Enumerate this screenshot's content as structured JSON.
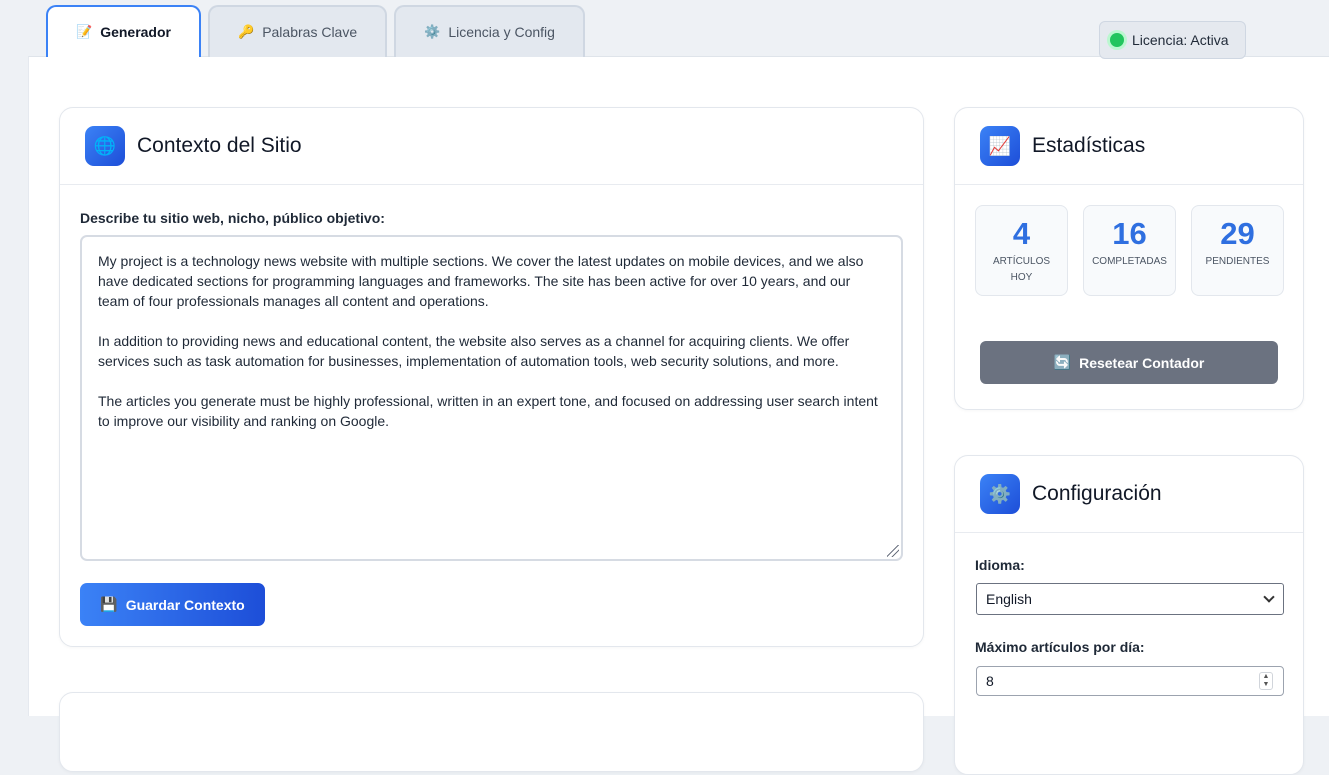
{
  "tabs": [
    {
      "label": "Generador",
      "icon": "📝",
      "active": true
    },
    {
      "label": "Palabras Clave",
      "icon": "🔑",
      "active": false
    },
    {
      "label": "Licencia y Config",
      "icon": "⚙️",
      "active": false
    }
  ],
  "license": {
    "label": "Licencia: Activa",
    "status_color": "#22c55e"
  },
  "context": {
    "title": "Contexto del Sitio",
    "icon": "🌐",
    "field_label": "Describe tu sitio web, nicho, público objetivo:",
    "text": "My project is a technology news website with multiple sections. We cover the latest updates on mobile devices, and we also have dedicated sections for programming languages and frameworks. The site has been active for over 10 years, and our team of four professionals manages all content and operations.\n\nIn addition to providing news and educational content, the website also serves as a channel for acquiring clients. We offer services such as task automation for businesses, implementation of automation tools, web security solutions, and more.\n\nThe articles you generate must be highly professional, written in an expert tone, and focused on addressing user search intent to improve our visibility and ranking on Google.",
    "save_label": "Guardar Contexto",
    "save_icon": "💾"
  },
  "stats": {
    "title": "Estadísticas",
    "icon": "📈",
    "items": [
      {
        "value": "4",
        "label": "Artículos Hoy"
      },
      {
        "value": "16",
        "label": "Completadas"
      },
      {
        "value": "29",
        "label": "Pendientes"
      }
    ],
    "reset_label": "Resetear Contador",
    "reset_icon": "🔄"
  },
  "config": {
    "title": "Configuración",
    "icon": "⚙️",
    "language_label": "Idioma:",
    "language_value": "English",
    "max_label": "Máximo artículos por día:",
    "max_value": "8"
  },
  "colors": {
    "accent": "#3b82f6",
    "accent_dark": "#1d4ed8",
    "stat_value": "#2f6fe0",
    "reset_button": "#6b7280"
  }
}
